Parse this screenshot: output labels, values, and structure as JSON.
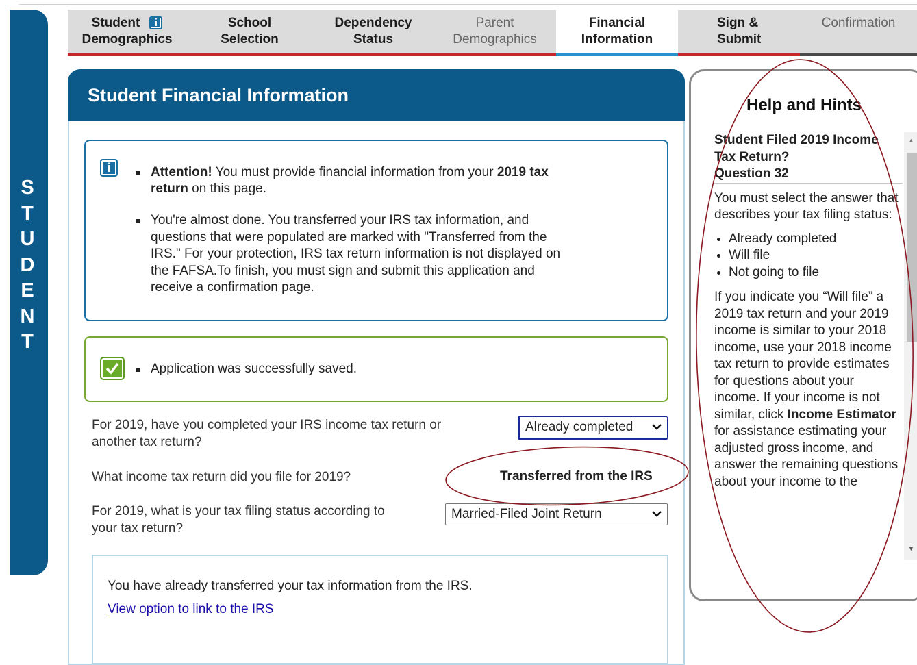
{
  "side_label": [
    "S",
    "T",
    "U",
    "D",
    "E",
    "N",
    "T"
  ],
  "tabs": [
    {
      "line1": "Student",
      "line2": "Demographics",
      "state": "normal",
      "info_icon": "i"
    },
    {
      "line1": "School",
      "line2": "Selection",
      "state": "normal"
    },
    {
      "line1": "Dependency",
      "line2": "Status",
      "state": "normal"
    },
    {
      "line1": "Parent",
      "line2": "Demographics",
      "state": "disabled"
    },
    {
      "line1": "Financial",
      "line2": "Information",
      "state": "active"
    },
    {
      "line1": "Sign &",
      "line2": "Submit",
      "state": "normal"
    },
    {
      "line1": "Confirmation",
      "line2": "",
      "state": "disabled"
    }
  ],
  "main": {
    "title": "Student Financial Information",
    "notice": {
      "icon": "i",
      "attention_bold": "Attention!",
      "attention_text": " You must provide financial information from your ",
      "attention_year_bold": "2019 tax",
      "attention_line2_bold": "return",
      "attention_line2_text": " on this page.",
      "p2_lines": [
        "You're almost done. You transferred your IRS tax information, and",
        "questions that were populated are marked with \"Transferred from the",
        "IRS.\" For your protection, IRS tax return information is not displayed on",
        "the FAFSA.To finish, you must sign and submit this application and",
        "receive a confirmation page."
      ]
    },
    "saved_message": "Application was successfully saved.",
    "questions": {
      "q1_line1": "For 2019, have you completed your IRS income tax return or",
      "q1_line2": "another tax return?",
      "q1_value": "Already completed",
      "q2": "What income tax return did you file for 2019?",
      "q2_value": "Transferred from the IRS",
      "q3_line1": "For 2019, what is your tax filing status according to",
      "q3_line2": "your tax return?",
      "q3_value": "Married-Filed Joint Return"
    },
    "irs_box": {
      "text": "You have already transferred your tax information from the IRS.",
      "link": "View option to link to the IRS"
    }
  },
  "help": {
    "title": "Help and Hints",
    "heading": "Student Filed 2019 Income Tax Return?",
    "question": "Question 32",
    "intro": "You must select the answer that describes your tax filing status:",
    "options": [
      "Already completed",
      "Will file",
      "Not going to file"
    ],
    "body_pre": "If you indicate you “Will file” a 2019 tax return and your 2019 income is similar to your 2018 income, use your 2018 income tax return to provide estimates for questions about your income. If your income is not similar, click ",
    "body_bold": "Income Estimator",
    "body_post": " for assistance estimating your adjusted gross income, and answer the remaining questions about your income to the"
  },
  "colors": {
    "brand_blue": "#0c5a8a",
    "tab_underline_red": "#c62828",
    "active_underline": "#2b8fc9",
    "success_green": "#77a832",
    "annotation_red": "#8b1a22"
  }
}
